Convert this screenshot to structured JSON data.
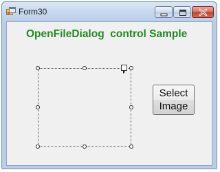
{
  "window": {
    "title": "Form30",
    "app_icon": "form-app-icon",
    "controls": {
      "minimize_icon": "minimize-icon",
      "maximize_icon": "maximize-icon",
      "close_icon": "close-icon"
    }
  },
  "form": {
    "heading": "OpenFileDialog  control Sample",
    "heading_color": "#1f8a1f",
    "picture_box": {
      "smart_tag_icon": "smart-tag-arrow-icon"
    },
    "select_button": {
      "line1": "Select",
      "line2": "Image"
    }
  },
  "colors": {
    "client_background": "#f0f0f0",
    "close_button": "#c1402c",
    "frame": "#b9cde6"
  }
}
